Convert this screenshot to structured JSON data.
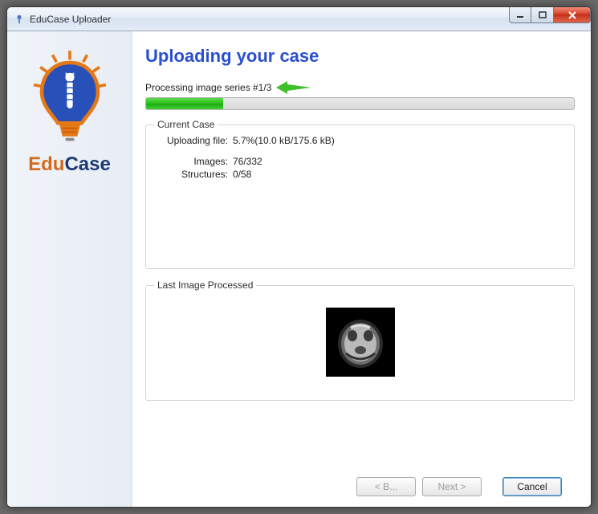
{
  "window": {
    "title": "EduCase Uploader"
  },
  "sidebar": {
    "logo_primary": "Edu",
    "logo_secondary": "Case"
  },
  "main": {
    "heading": "Uploading your case",
    "status": "Processing image series #1/3",
    "progress_percent": 18
  },
  "current_case": {
    "group_title": "Current Case",
    "uploading_label": "Uploading file:",
    "uploading_value": "5.7%(10.0 kB/175.6 kB)",
    "images_label": "Images:",
    "images_value": "76/332",
    "structures_label": "Structures:",
    "structures_value": "0/58"
  },
  "last_image": {
    "group_title": "Last Image Processed"
  },
  "footer": {
    "back_label": "< B...",
    "next_label": "Next >",
    "cancel_label": "Cancel"
  }
}
